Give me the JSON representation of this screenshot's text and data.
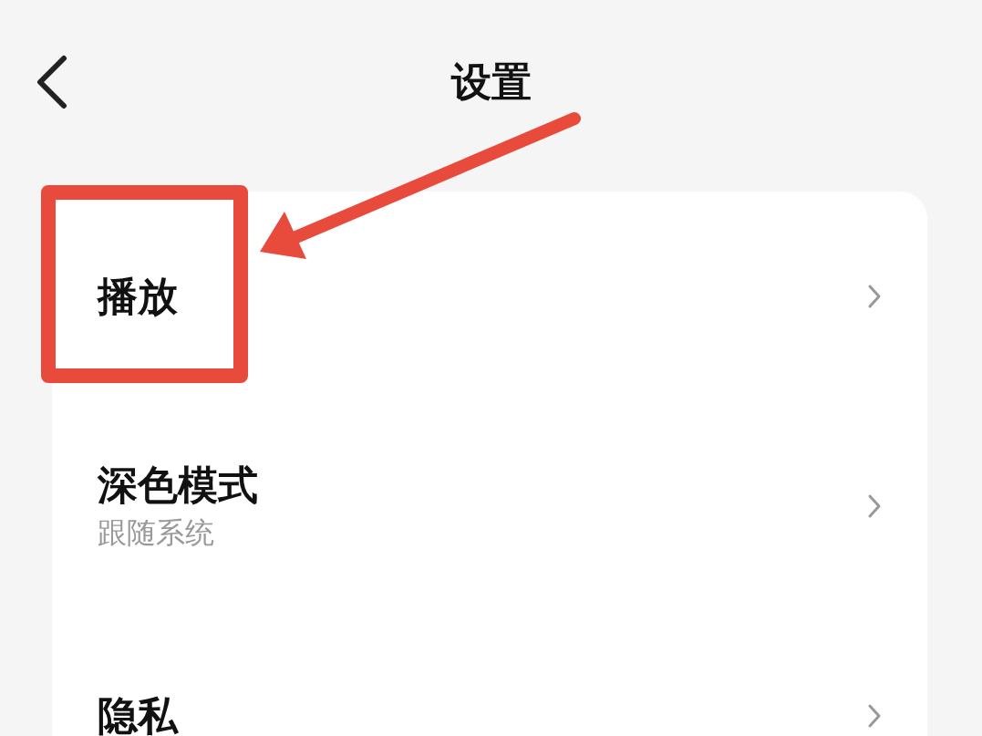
{
  "header": {
    "title": "设置"
  },
  "settings": [
    {
      "title": "播放",
      "highlighted": true
    },
    {
      "title": "深色模式",
      "subtitle": "跟随系统",
      "highlighted": false
    },
    {
      "title": "隐私",
      "highlighted": false
    }
  ]
}
